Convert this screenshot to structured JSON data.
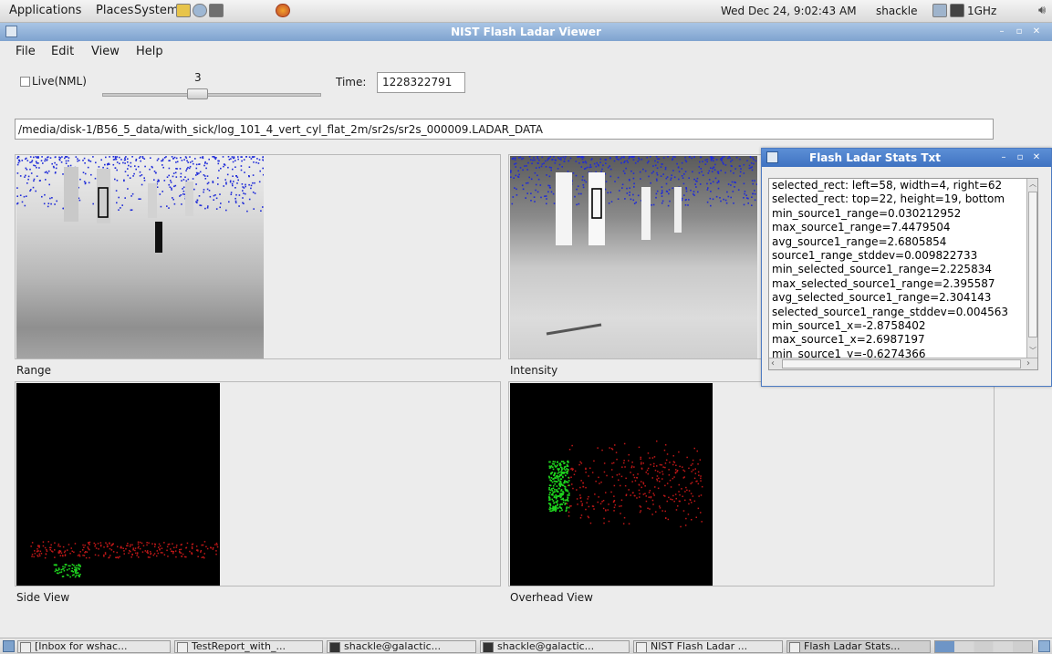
{
  "top_panel": {
    "menus": [
      "Applications",
      "Places",
      "System"
    ],
    "clock": "Wed Dec 24,  9:02:43 AM",
    "user": "shackle",
    "cpu": "1GHz"
  },
  "window": {
    "title": "NIST Flash Ladar Viewer",
    "menu": [
      "File",
      "Edit",
      "View",
      "Help"
    ],
    "live_label": "Live(NML)",
    "slider_value": "3",
    "time_label": "Time:",
    "time_value": "1228322791",
    "path": "/media/disk-1/B56_5_data/with_sick/log_101_4_vert_cyl_flat_2m/sr2s/sr2s_000009.LADAR_DATA",
    "panels": {
      "range": "Range",
      "intensity": "Intensity",
      "side": "Side View",
      "overhead": "Overhead View"
    }
  },
  "stats": {
    "title": "Flash Ladar Stats Txt",
    "lines": [
      "selected_rect: left=58, width=4, right=62",
      "selected_rect: top=22, height=19, bottom",
      "min_source1_range=0.030212952",
      "max_source1_range=7.4479504",
      "avg_source1_range=2.6805854",
      "source1_range_stddev=0.009822733",
      "min_selected_source1_range=2.225834",
      "max_selected_source1_range=2.395587",
      "avg_selected_source1_range=2.304143",
      "selected_source1_range_stddev=0.004563",
      "min_source1_x=-2.8758402",
      "max_source1_x=2.6987197",
      "min_source1_y=-0.6274366"
    ]
  },
  "taskbar": [
    "[Inbox for wshac...",
    "TestReport_with_...",
    "shackle@galactic...",
    "shackle@galactic...",
    "NIST Flash Ladar ...",
    "Flash Ladar Stats..."
  ],
  "colors": {
    "titlebar": "#7fa3cf",
    "stats_titlebar": "#3f72c1",
    "point_blue": "#1f2bd8",
    "point_red": "#c01818",
    "point_green": "#1ed41e"
  }
}
